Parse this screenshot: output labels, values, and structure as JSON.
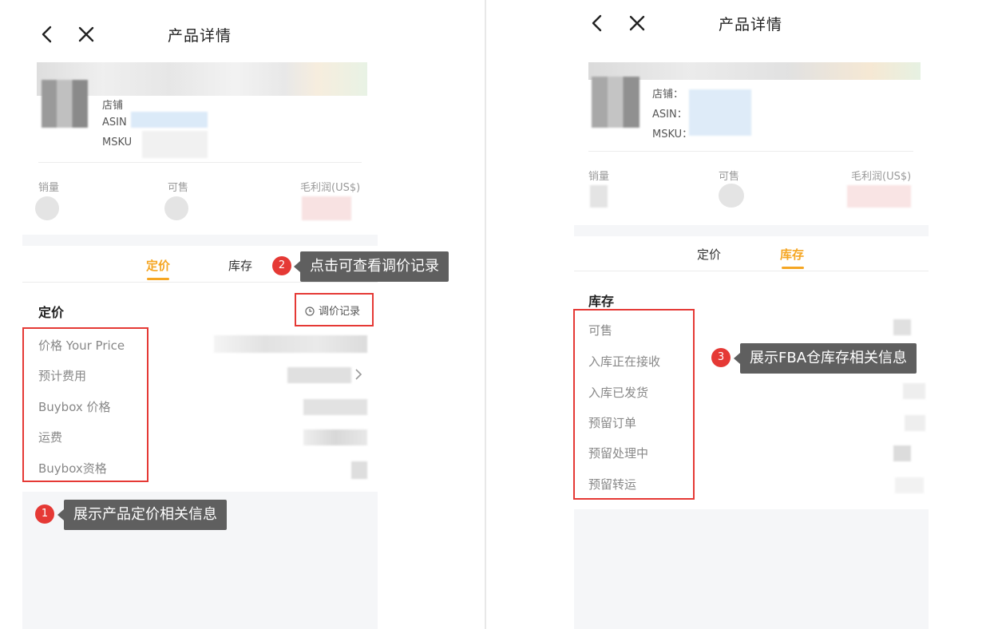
{
  "left": {
    "title": "产品详情",
    "meta": {
      "store_label": "店铺",
      "asin_label": "ASIN",
      "msku_label": "MSKU"
    },
    "stats": {
      "sales_label": "销量",
      "available_label": "可售",
      "profit_label": "毛利润(US$)"
    },
    "tabs": [
      {
        "label": "定价",
        "active": true
      },
      {
        "label": "库存",
        "active": false
      }
    ],
    "section_title": "定价",
    "history_link": "调价记录",
    "rows": [
      "价格 Your Price",
      "预计费用",
      "Buybox 价格",
      "运费",
      "Buybox资格"
    ],
    "annotations": [
      {
        "number": "1",
        "text": "展示产品定价相关信息"
      },
      {
        "number": "2",
        "text": "点击可查看调价记录"
      }
    ]
  },
  "right": {
    "title": "产品详情",
    "meta": {
      "store_label": "店铺：",
      "asin_label": "ASIN：",
      "msku_label": "MSKU："
    },
    "stats": {
      "sales_label": "销量",
      "available_label": "可售",
      "profit_label": "毛利润(US$)"
    },
    "tabs": [
      {
        "label": "定价",
        "active": false
      },
      {
        "label": "库存",
        "active": true
      }
    ],
    "section_title": "库存",
    "rows": [
      "可售",
      "入库正在接收",
      "入库已发货",
      "预留订单",
      "预留处理中",
      "预留转运"
    ],
    "annotations": [
      {
        "number": "3",
        "text": "展示FBA仓库存相关信息"
      }
    ]
  },
  "colors": {
    "accent": "#f5a623",
    "highlight": "#e53935",
    "tooltip_bg": "#5f5f5f"
  },
  "icons": [
    "back-icon",
    "close-icon",
    "history-clock-icon",
    "chevron-right-icon"
  ]
}
